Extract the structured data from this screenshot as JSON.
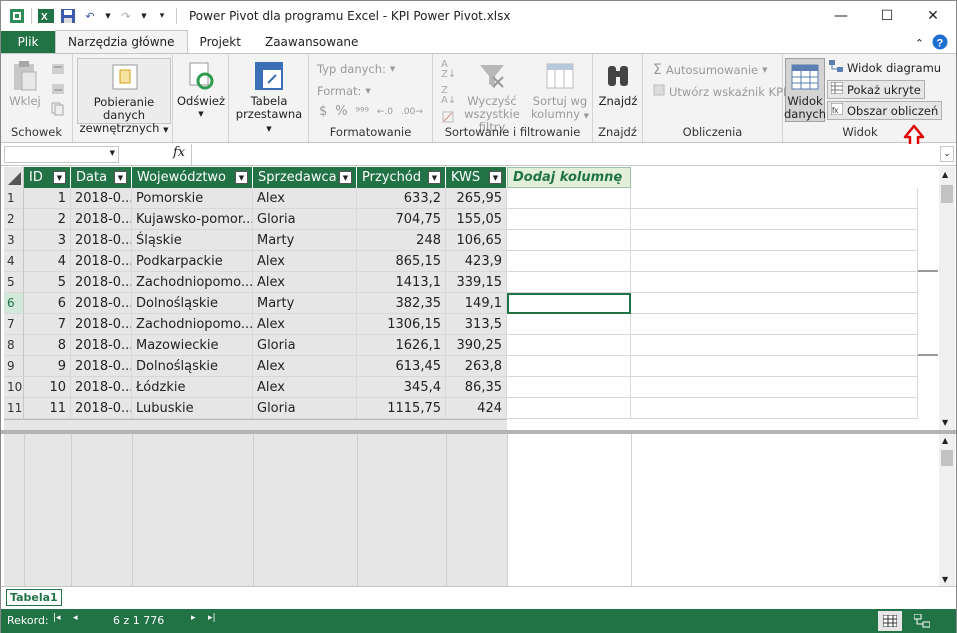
{
  "window": {
    "title": "Power Pivot dla programu Excel - KPI Power Pivot.xlsx"
  },
  "tabs": [
    {
      "label": "Plik"
    },
    {
      "label": "Narzędzia główne"
    },
    {
      "label": "Projekt"
    },
    {
      "label": "Zaawansowane"
    }
  ],
  "ribbon": {
    "schowek": {
      "label": "Schowek",
      "paste": "Wklej"
    },
    "pobieranie": {
      "line1": "Pobieranie danych",
      "line2": "zewnętrznych"
    },
    "odswiez": "Odśwież",
    "tabela": {
      "line1": "Tabela",
      "line2": "przestawna"
    },
    "formatowanie": {
      "label": "Formatowanie",
      "typ": "Typ danych:",
      "format": "Format:",
      "sym1": "$",
      "sym2": "%",
      "sym3": "⁹⁹⁹"
    },
    "sortowanie": {
      "label": "Sortowanie i filtrowanie",
      "clear_line1": "Wyczyść",
      "clear_line2": "wszystkie filtry",
      "sort_line1": "Sortuj wg",
      "sort_line2": "kolumny"
    },
    "znajdz": {
      "label": "Znajdź",
      "button": "Znajdź"
    },
    "obliczenia": {
      "label": "Obliczenia",
      "autosum": "Autosumowanie",
      "kpi": "Utwórz wskaźnik KPI"
    },
    "widok": {
      "label": "Widok",
      "data_line1": "Widok",
      "data_line2": "danych",
      "diagram": "Widok diagramu",
      "hidden": "Pokaż ukryte",
      "calc_area": "Obszar obliczeń"
    }
  },
  "formula": {
    "fx": "fx"
  },
  "columns": [
    {
      "label": "ID"
    },
    {
      "label": "Data"
    },
    {
      "label": "Województwo"
    },
    {
      "label": "Sprzedawca"
    },
    {
      "label": "Przychód"
    },
    {
      "label": "KWS"
    }
  ],
  "add_column": "Dodaj kolumnę",
  "rows": [
    {
      "n": "1",
      "id": "1",
      "data": "2018-0...",
      "woj": "Pomorskie",
      "spr": "Alex",
      "prz": "633,2",
      "kws": "265,95"
    },
    {
      "n": "2",
      "id": "2",
      "data": "2018-0...",
      "woj": "Kujawsko-pomor...",
      "spr": "Gloria",
      "prz": "704,75",
      "kws": "155,05"
    },
    {
      "n": "3",
      "id": "3",
      "data": "2018-0...",
      "woj": "Śląskie",
      "spr": "Marty",
      "prz": "248",
      "kws": "106,65"
    },
    {
      "n": "4",
      "id": "4",
      "data": "2018-0...",
      "woj": "Podkarpackie",
      "spr": "Alex",
      "prz": "865,15",
      "kws": "423,9"
    },
    {
      "n": "5",
      "id": "5",
      "data": "2018-0...",
      "woj": "Zachodniopomo...",
      "spr": "Alex",
      "prz": "1413,1",
      "kws": "339,15"
    },
    {
      "n": "6",
      "id": "6",
      "data": "2018-0...",
      "woj": "Dolnośląskie",
      "spr": "Marty",
      "prz": "382,35",
      "kws": "149,1"
    },
    {
      "n": "7",
      "id": "7",
      "data": "2018-0...",
      "woj": "Zachodniopomo...",
      "spr": "Alex",
      "prz": "1306,15",
      "kws": "313,5"
    },
    {
      "n": "8",
      "id": "8",
      "data": "2018-0...",
      "woj": "Mazowieckie",
      "spr": "Gloria",
      "prz": "1626,1",
      "kws": "390,25"
    },
    {
      "n": "9",
      "id": "9",
      "data": "2018-0...",
      "woj": "Dolnośląskie",
      "spr": "Alex",
      "prz": "613,45",
      "kws": "263,8"
    },
    {
      "n": "10",
      "id": "10",
      "data": "2018-0...",
      "woj": "Łódzkie",
      "spr": "Alex",
      "prz": "345,4",
      "kws": "86,35"
    },
    {
      "n": "11",
      "id": "11",
      "data": "2018-0...",
      "woj": "Lubuskie",
      "spr": "Gloria",
      "prz": "1115,75",
      "kws": "424"
    }
  ],
  "sheet": {
    "tab": "Tabela1"
  },
  "status": {
    "record_label": "Rekord:",
    "position": "6 z 1 776"
  },
  "colors": {
    "accent": "#217346",
    "arrow": "#e00000"
  }
}
